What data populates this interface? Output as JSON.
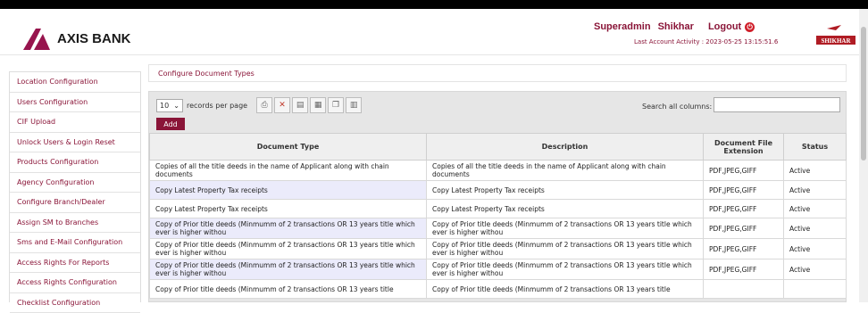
{
  "header": {
    "brand": "AXIS BANK",
    "user_role": "Superadmin",
    "user_name": "Shikhar",
    "logout_label": "Logout",
    "last_activity": "Last Account Activity : 2023-05-25 13:15:51.6",
    "right_logo_text": "SHIKHAR"
  },
  "sidebar": {
    "items": [
      "Location Configuration",
      "Users Configuration",
      "CIF Upload",
      "Unlock Users & Login Reset",
      "Products Configuration",
      "Agency Configuration",
      "Configure Branch/Dealer",
      "Assign SM to Branches",
      "Sms and E-Mail Configuration",
      "Access Rights For Reports",
      "Access Rights Configuration",
      "Checklist Configuration"
    ]
  },
  "main": {
    "breadcrumb": "Configure Document Types",
    "page_size": "10",
    "records_label": "records per page",
    "search_label": "Search all columns:",
    "add_label": "Add",
    "columns": [
      "Document Type",
      "Description",
      "Document File Extension",
      "Status"
    ],
    "rows": [
      [
        "Copies of all the title deeds in the name of Applicant along with chain documents",
        "Copies of all the title deeds in the name of Applicant along with chain documents",
        "PDF,JPEG,GIFF",
        "Active"
      ],
      [
        "Copy Latest Property Tax receipts",
        "Copy Latest Property Tax receipts",
        "PDF,JPEG,GIFF",
        "Active"
      ],
      [
        "Copy Latest Property Tax receipts",
        "Copy Latest Property Tax receipts",
        "PDF,JPEG,GIFF",
        "Active"
      ],
      [
        "Copy of Prior title deeds (Minmumm of 2 transactions OR 13 years title which ever is higher withou",
        "Copy of Prior title deeds (Minmumm of 2 transactions OR 13 years title which ever is higher withou",
        "PDF,JPEG,GIFF",
        "Active"
      ],
      [
        "Copy of Prior title deeds (Minmumm of 2 transactions OR 13 years title which ever is higher withou",
        "Copy of Prior title deeds (Minmumm of 2 transactions OR 13 years title which ever is higher withou",
        "PDF,JPEG,GIFF",
        "Active"
      ],
      [
        "Copy of Prior title deeds (Minmumm of 2 transactions OR 13 years title which ever is higher withou",
        "Copy of Prior title deeds (Minmumm of 2 transactions OR 13 years title which ever is higher withou",
        "PDF,JPEG,GIFF",
        "Active"
      ],
      [
        "Copy of Prior title deeds (Minmumm of 2 transactions OR 13 years title",
        "Copy of Prior title deeds (Minmumm of 2 transactions OR 13 years title",
        "",
        ""
      ]
    ]
  },
  "colors": {
    "accent": "#8a1538",
    "logout": "#d01f2a"
  }
}
